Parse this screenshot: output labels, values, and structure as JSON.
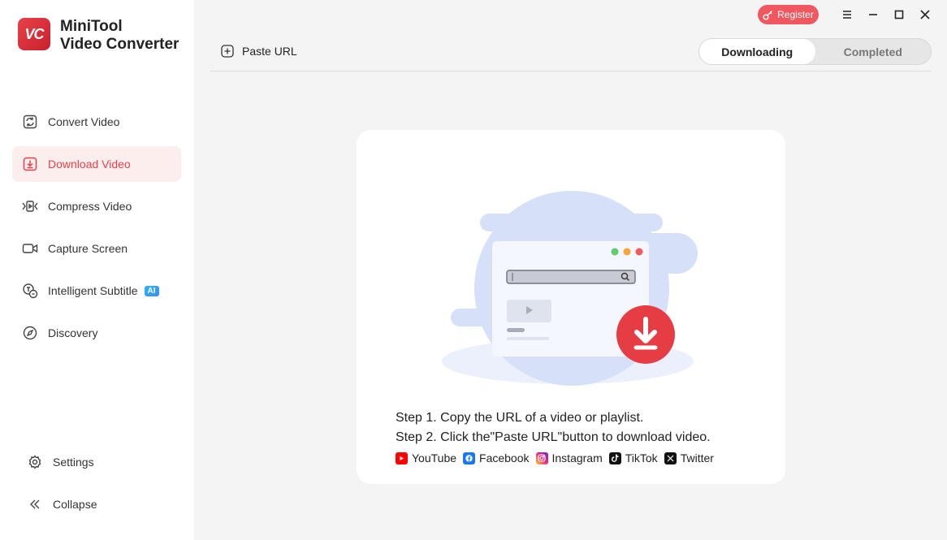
{
  "app": {
    "logo_text": "VC",
    "name_line1": "MiniTool",
    "name_line2": "Video Converter"
  },
  "sidebar": {
    "items": [
      {
        "label": "Convert Video",
        "icon": "convert-icon"
      },
      {
        "label": "Download Video",
        "icon": "download-icon",
        "active": true
      },
      {
        "label": "Compress Video",
        "icon": "compress-icon"
      },
      {
        "label": "Capture Screen",
        "icon": "camera-icon"
      },
      {
        "label": "Intelligent Subtitle",
        "icon": "subtitle-icon",
        "badge": "AI"
      },
      {
        "label": "Discovery",
        "icon": "compass-icon"
      }
    ],
    "settings_label": "Settings",
    "collapse_label": "Collapse"
  },
  "header": {
    "register_label": "Register",
    "paste_url_label": "Paste URL",
    "tabs": [
      {
        "label": "Downloading",
        "active": true
      },
      {
        "label": "Completed"
      }
    ]
  },
  "card": {
    "step1": "Step 1. Copy the URL of a video or playlist.",
    "step2": "Step 2. Click the\"Paste URL\"button to download video.",
    "platforms": [
      {
        "name": "YouTube",
        "color": "#ff0000"
      },
      {
        "name": "Facebook",
        "color": "#1877f2"
      },
      {
        "name": "Instagram",
        "color": "#d62976"
      },
      {
        "name": "TikTok",
        "color": "#111111"
      },
      {
        "name": "Twitter",
        "color": "#111111"
      }
    ]
  },
  "colors": {
    "accent": "#e8414a",
    "active_bg": "#fdeeee",
    "register": "#f0575f"
  }
}
